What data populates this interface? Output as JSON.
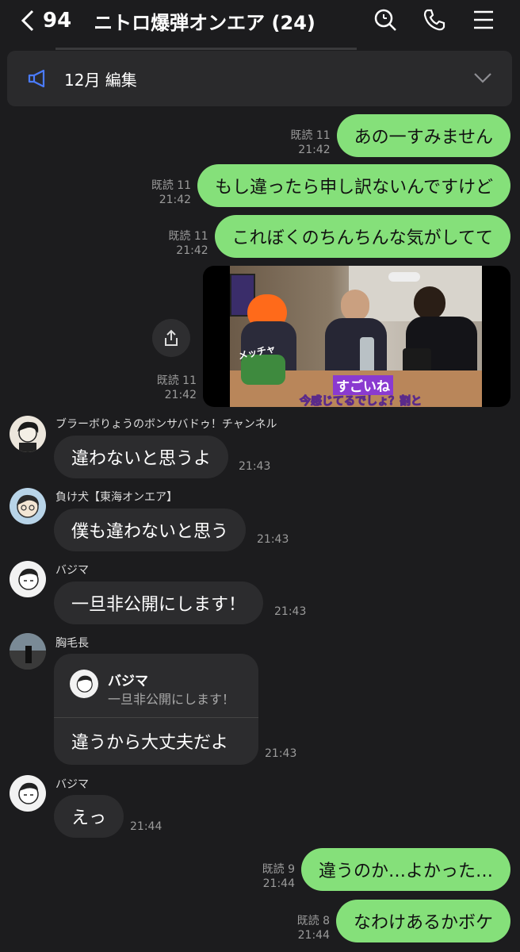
{
  "header": {
    "back_count": "94",
    "title": "ニトロ爆弾オンエア (24)",
    "icons": [
      "search-icon",
      "phone-icon",
      "menu-icon"
    ]
  },
  "notice": {
    "text": "12月 編集",
    "icon": "megaphone-icon"
  },
  "colors": {
    "background": "#1c1c1e",
    "outgoing_bubble": "#85e07a",
    "incoming_bubble": "#2c2c2e",
    "accent_icon": "#4a7bff"
  },
  "messages_out": [
    {
      "read": "既読 11",
      "time": "21:42",
      "text": "あの一すみません"
    },
    {
      "read": "既読 11",
      "time": "21:42",
      "text": "もし違ったら申し訳ないんですけど"
    },
    {
      "read": "既読 11",
      "time": "21:42",
      "text": "これぼくのちんちんな気がしてて"
    }
  ],
  "media_message": {
    "read": "既読 11",
    "time": "21:42",
    "overlay_top": "メッチャ",
    "caption1": "すごいね",
    "caption2": "今感じてるでしょ？割と"
  },
  "messages_in": [
    {
      "sender": "ブラーボりょうのボンサバドゥ！チャンネル",
      "text": "違わないと思うよ",
      "time": "21:43"
    },
    {
      "sender": "負け犬【東海オンエア】",
      "text": "僕も違わないと思う",
      "time": "21:43"
    },
    {
      "sender": "バジマ",
      "text": "一旦非公開にします！",
      "time": "21:43"
    }
  ],
  "reply_message": {
    "sender": "胸毛長",
    "quoted_name": "バジマ",
    "quoted_text": "一旦非公開にします！",
    "text": "違うから大丈夫だよ",
    "time": "21:43"
  },
  "message_in_last": {
    "sender": "バジマ",
    "text": "えっ",
    "time": "21:44"
  },
  "messages_out_bottom": [
    {
      "read": "既読 9",
      "time": "21:44",
      "text": "違うのか…よかった…"
    },
    {
      "read": "既読 8",
      "time": "21:44",
      "text": "なわけあるかボケ"
    }
  ]
}
